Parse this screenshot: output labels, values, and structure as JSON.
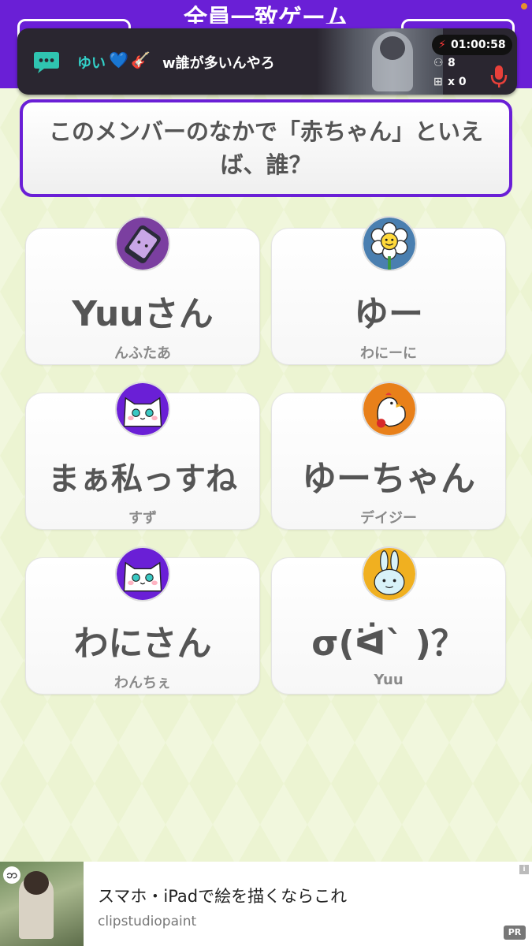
{
  "header": {
    "title": "全員一致ゲーム"
  },
  "stream": {
    "chat_user": "ゆい",
    "chat_message": "w誰が多いんやろ",
    "chat_emoji_1": "💙",
    "chat_emoji_2": "🎸",
    "timer": "01:00:58",
    "viewers": "8",
    "gifts": "x 0"
  },
  "question": {
    "text": "このメンバーのなかで「赤ちゃん」といえば、誰？"
  },
  "answers": [
    {
      "answer": "Yuuさん",
      "player": "んふたあ",
      "avatar": "phone-icon",
      "avatar_color": "#7b3fa0"
    },
    {
      "answer": "ゆー",
      "player": "わにーに",
      "avatar": "flower-icon",
      "avatar_color": "#4a7fb0"
    },
    {
      "answer": "まぁ私っすね",
      "player": "すず",
      "avatar": "cat-icon",
      "avatar_color": "#6a1fd6"
    },
    {
      "answer": "ゆーちゃん",
      "player": "デイジー",
      "avatar": "bird-icon",
      "avatar_color": "#e8801a"
    },
    {
      "answer": "わにさん",
      "player": "わんちぇ",
      "avatar": "cat-icon",
      "avatar_color": "#6a1fd6"
    },
    {
      "answer": "σ(ᐛ` )？",
      "player": "Yuu",
      "avatar": "rabbit-icon",
      "avatar_color": "#f0b020"
    }
  ],
  "ad": {
    "title": "スマホ・iPadで絵を描くならこれ",
    "subtitle": "clipstudiopaint",
    "badge": "PR",
    "info": "i"
  },
  "colors": {
    "accent": "#6a1fd6",
    "background": "#ecf4d2"
  }
}
